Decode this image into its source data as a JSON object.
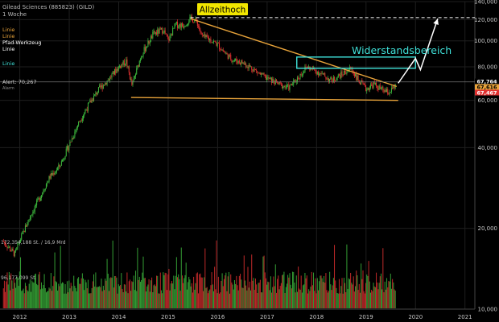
{
  "header": {
    "title": "Gilead Sciences (885823) (GILD)",
    "interval": "1 Woche",
    "legend": [
      {
        "label": "Linie",
        "color": "#e8a33a"
      },
      {
        "label": "Linie",
        "color": "#e8a33a"
      },
      {
        "label": "Pfad-Werkzeug",
        "color": "#ffffff"
      },
      {
        "label": "Linie",
        "color": "#ffffff"
      },
      {
        "label": "Linie",
        "color": "#3fe0d8"
      }
    ]
  },
  "annotations": {
    "ath_label": "Allzeithoch",
    "resistance_label": "Widerstandsbereich",
    "alert_label": "Alert: 70,267",
    "alert_sub": "Alarm"
  },
  "price_labels": [
    {
      "text": "67,764",
      "bg": "#000000",
      "fg": "#ffffff"
    },
    {
      "text": "67,616",
      "bg": "#e8a33a",
      "fg": "#000000"
    },
    {
      "text": "67,467",
      "bg": "#e03030",
      "fg": "#ffffff"
    }
  ],
  "volume_labels": {
    "upper": "172,354,188 St. / 16,9 Mrd",
    "lower": "96,177,099 St."
  },
  "colors": {
    "up": "#3db83d",
    "down": "#e03030",
    "trend": "#e8a33a",
    "resistance": "#3fe0d8",
    "projection": "#ffffff",
    "grid": "#1e1e1e",
    "axis_text": "#c8c8c8",
    "ath_badge": "#f2e600"
  },
  "chart_data": {
    "type": "candlestick",
    "y_scale": "log",
    "ylim": [
      10000,
      140000
    ],
    "y_ticks": [
      {
        "value": 140000,
        "label": "140,000"
      },
      {
        "value": 120000,
        "label": "120,000"
      },
      {
        "value": 100000,
        "label": "100,000"
      },
      {
        "value": 80000,
        "label": "80,000"
      },
      {
        "value": 60000,
        "label": "60,000"
      },
      {
        "value": 40000,
        "label": "40,000"
      },
      {
        "value": 20000,
        "label": "20,000"
      },
      {
        "value": 10000,
        "label": "10,000"
      }
    ],
    "xlim": [
      2011.6,
      2021.2
    ],
    "x_ticks": [
      {
        "value": 2012,
        "label": "2012"
      },
      {
        "value": 2013,
        "label": "2013"
      },
      {
        "value": 2014,
        "label": "2014"
      },
      {
        "value": 2015,
        "label": "2015"
      },
      {
        "value": 2016,
        "label": "2016"
      },
      {
        "value": 2017,
        "label": "2017"
      },
      {
        "value": 2018,
        "label": "2018"
      },
      {
        "value": 2019,
        "label": "2019"
      },
      {
        "value": 2020,
        "label": "2020"
      },
      {
        "value": 2021,
        "label": "2021"
      }
    ],
    "price_path": [
      [
        2011.65,
        18000
      ],
      [
        2011.9,
        16000
      ],
      [
        2012.0,
        18000
      ],
      [
        2012.2,
        22000
      ],
      [
        2012.4,
        26000
      ],
      [
        2012.6,
        31000
      ],
      [
        2012.8,
        34000
      ],
      [
        2013.0,
        41000
      ],
      [
        2013.2,
        50000
      ],
      [
        2013.4,
        58000
      ],
      [
        2013.6,
        66000
      ],
      [
        2013.8,
        72000
      ],
      [
        2014.0,
        80000
      ],
      [
        2014.15,
        84000
      ],
      [
        2014.27,
        68000
      ],
      [
        2014.45,
        88000
      ],
      [
        2014.7,
        106000
      ],
      [
        2014.9,
        110000
      ],
      [
        2015.0,
        100000
      ],
      [
        2015.15,
        115000
      ],
      [
        2015.3,
        114000
      ],
      [
        2015.45,
        121000
      ],
      [
        2015.58,
        118000
      ],
      [
        2015.68,
        104000
      ],
      [
        2015.85,
        101000
      ],
      [
        2016.0,
        97000
      ],
      [
        2016.15,
        90000
      ],
      [
        2016.3,
        85000
      ],
      [
        2016.5,
        83000
      ],
      [
        2016.7,
        79000
      ],
      [
        2016.9,
        74000
      ],
      [
        2017.1,
        71000
      ],
      [
        2017.3,
        68000
      ],
      [
        2017.45,
        67000
      ],
      [
        2017.6,
        72000
      ],
      [
        2017.8,
        80000
      ],
      [
        2018.0,
        77000
      ],
      [
        2018.15,
        74000
      ],
      [
        2018.3,
        71000
      ],
      [
        2018.5,
        75000
      ],
      [
        2018.7,
        79000
      ],
      [
        2018.85,
        71000
      ],
      [
        2019.0,
        66000
      ],
      [
        2019.15,
        69000
      ],
      [
        2019.3,
        66000
      ],
      [
        2019.45,
        64000
      ],
      [
        2019.6,
        67600
      ]
    ],
    "last_date": 2019.6,
    "volume_ylim": [
      0,
      172354188
    ],
    "volume_baseline": 58000000,
    "trendlines": [
      {
        "name": "upper",
        "points": [
          [
            2015.45,
            121000
          ],
          [
            2019.62,
            67600
          ]
        ]
      },
      {
        "name": "lower",
        "points": [
          [
            2014.25,
            61500
          ],
          [
            2019.65,
            60000
          ]
        ]
      }
    ],
    "ath_level": {
      "value": 122000,
      "from": 2015.45,
      "to": 2021.2
    },
    "resistance_zone": {
      "low": 79000,
      "high": 87000,
      "from": 2017.6,
      "to": 2020.0
    },
    "projection_path": [
      [
        2019.65,
        69500
      ],
      [
        2020.0,
        86000
      ],
      [
        2020.1,
        78000
      ],
      [
        2020.45,
        121000
      ]
    ],
    "alert_level": 70267
  }
}
